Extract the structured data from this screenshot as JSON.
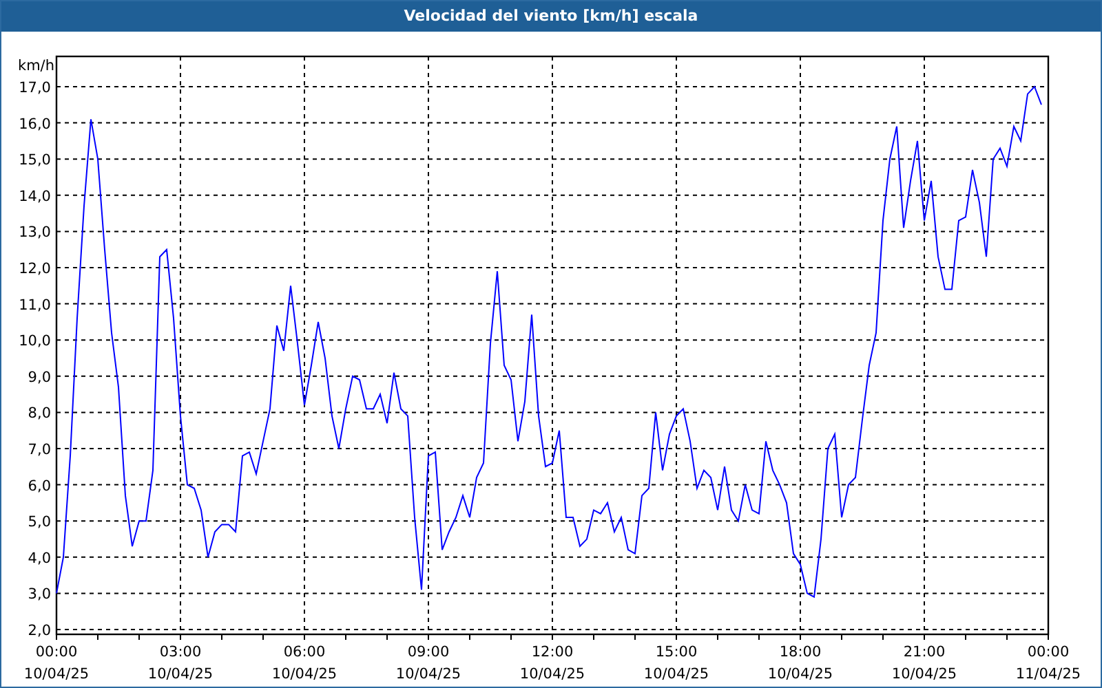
{
  "window": {
    "title": "Velocidad del viento [km/h] escala"
  },
  "chart": {
    "chart_data": {
      "type": "line",
      "ylabel": "km/h",
      "categories": [
        "00:00\n10/04/25",
        null,
        null,
        null,
        null,
        null,
        null,
        null,
        null,
        null,
        null,
        null,
        null,
        null,
        null,
        null,
        null,
        null,
        "03:00\n10/04/25",
        null,
        null,
        null,
        null,
        null,
        null,
        null,
        null,
        null,
        null,
        null,
        null,
        null,
        null,
        null,
        null,
        null,
        "06:00\n10/04/25",
        null,
        null,
        null,
        null,
        null,
        null,
        null,
        null,
        null,
        null,
        null,
        null,
        null,
        null,
        null,
        null,
        null,
        "09:00\n10/04/25",
        null,
        null,
        null,
        null,
        null,
        null,
        null,
        null,
        null,
        null,
        null,
        null,
        null,
        null,
        null,
        null,
        null,
        "12:00\n10/04/25",
        null,
        null,
        null,
        null,
        null,
        null,
        null,
        null,
        null,
        null,
        null,
        null,
        null,
        null,
        null,
        null,
        null,
        "15:00\n10/04/25",
        null,
        null,
        null,
        null,
        null,
        null,
        null,
        null,
        null,
        null,
        null,
        null,
        null,
        null,
        null,
        null,
        null,
        "18:00\n10/04/25",
        null,
        null,
        null,
        null,
        null,
        null,
        null,
        null,
        null,
        null,
        null,
        null,
        null,
        null,
        null,
        null,
        null,
        "21:00\n10/04/25",
        null,
        null,
        null,
        null,
        null,
        null,
        null,
        null,
        null,
        null,
        null,
        null,
        null,
        null,
        null,
        null,
        null,
        "00:00\n11/04/25"
      ],
      "series": [
        {
          "color": "#0000ff",
          "values": [
            3.0,
            4.0,
            6.8,
            10.6,
            13.7,
            16.1,
            15.0,
            12.5,
            10.2,
            8.7,
            5.7,
            4.3,
            5.0,
            5.0,
            6.4,
            12.3,
            12.5,
            10.6,
            7.9,
            6.0,
            5.9,
            5.3,
            4.0,
            4.7,
            4.9,
            4.9,
            4.7,
            6.8,
            6.9,
            6.3,
            7.2,
            8.1,
            10.4,
            9.7,
            11.5,
            9.9,
            8.2,
            9.3,
            10.5,
            9.5,
            7.9,
            7.0,
            8.1,
            9.0,
            8.9,
            8.1,
            8.1,
            8.5,
            7.7,
            9.1,
            8.1,
            7.9,
            5.1,
            3.1,
            6.8,
            6.9,
            4.2,
            4.7,
            5.1,
            5.7,
            5.1,
            6.2,
            6.6,
            9.9,
            11.9,
            9.3,
            8.9,
            7.2,
            8.3,
            10.7,
            7.9,
            6.5,
            6.6,
            7.5,
            5.1,
            5.1,
            4.3,
            4.5,
            5.3,
            5.2,
            5.5,
            4.7,
            5.1,
            4.2,
            4.1,
            5.7,
            5.9,
            8.0,
            6.4,
            7.4,
            7.9,
            8.1,
            7.2,
            5.9,
            6.4,
            6.2,
            5.3,
            6.5,
            5.3,
            5.0,
            6.0,
            5.3,
            5.2,
            7.2,
            6.4,
            6.0,
            5.5,
            4.1,
            3.8,
            3.0,
            2.9,
            4.5,
            7.0,
            7.4,
            5.1,
            6.0,
            6.2,
            7.8,
            9.3,
            10.2,
            13.3,
            15.0,
            15.9,
            13.1,
            14.4,
            15.5,
            13.3,
            14.4,
            12.3,
            11.4,
            11.4,
            13.3,
            13.4,
            14.7,
            13.8,
            12.3,
            15.0,
            15.3,
            14.8,
            15.9,
            15.5,
            16.8,
            17.0,
            16.5,
            null
          ]
        }
      ],
      "grid": true,
      "ylim": [
        2,
        17
      ],
      "yticks": [
        {
          "value": 2,
          "label": "2,0"
        },
        {
          "value": 3,
          "label": "3,0"
        },
        {
          "value": 4,
          "label": "4,0"
        },
        {
          "value": 5,
          "label": "5,0"
        },
        {
          "value": 6,
          "label": "6,0"
        },
        {
          "value": 7,
          "label": "7,0"
        },
        {
          "value": 8,
          "label": "8,0"
        },
        {
          "value": 9,
          "label": "9,0"
        },
        {
          "value": 10,
          "label": "10,0"
        },
        {
          "value": 11,
          "label": "11,0"
        },
        {
          "value": 12,
          "label": "12,0"
        },
        {
          "value": 13,
          "label": "13,0"
        },
        {
          "value": 14,
          "label": "14,0"
        },
        {
          "value": 15,
          "label": "15,0"
        },
        {
          "value": 16,
          "label": "16,0"
        },
        {
          "value": 17,
          "label": "17,0"
        }
      ]
    }
  }
}
